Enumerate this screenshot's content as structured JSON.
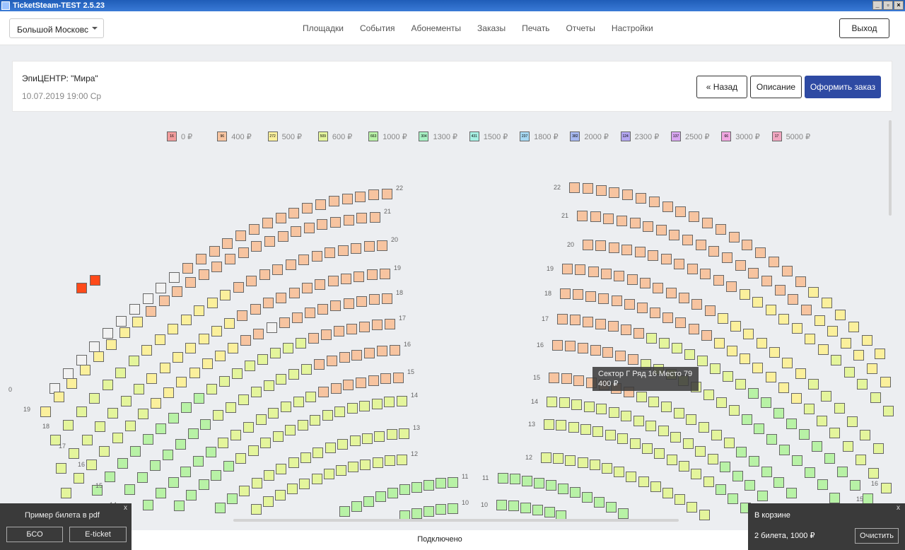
{
  "window": {
    "title": "TicketSteam-TEST 2.5.23"
  },
  "header": {
    "city": "Большой Московс",
    "nav": [
      "Площадки",
      "События",
      "Абонементы",
      "Заказы",
      "Печать",
      "Отчеты",
      "Настройки"
    ],
    "exit_label": "Выход"
  },
  "event": {
    "title": "ЭпиЦЕНТР: \"Мира\"",
    "date": "10.07.2019 19:00  Ср",
    "back_label": "«  Назад",
    "description_label": "Описание",
    "order_label": "Оформить заказ"
  },
  "legend": [
    {
      "count": "16",
      "price": "0 ₽",
      "color": "#f19c9c"
    },
    {
      "count": "96",
      "price": "400 ₽",
      "color": "#f7c4a0"
    },
    {
      "count": "272",
      "price": "500 ₽",
      "color": "#fbf09c"
    },
    {
      "count": "509",
      "price": "600 ₽",
      "color": "#e4f59c"
    },
    {
      "count": "663",
      "price": "1000 ₽",
      "color": "#b8f2a6"
    },
    {
      "count": "304",
      "price": "1300 ₽",
      "color": "#a6f0c2"
    },
    {
      "count": "431",
      "price": "1500 ₽",
      "color": "#a6f0e3"
    },
    {
      "count": "237",
      "price": "1800 ₽",
      "color": "#a6d8f2"
    },
    {
      "count": "382",
      "price": "2000 ₽",
      "color": "#a6b8f0"
    },
    {
      "count": "124",
      "price": "2300 ₽",
      "color": "#b3a6f0"
    },
    {
      "count": "137",
      "price": "2500 ₽",
      "color": "#d8a6f0"
    },
    {
      "count": "66",
      "price": "3000 ₽",
      "color": "#f0a6e0"
    },
    {
      "count": "17",
      "price": "5000 ₽",
      "color": "#f0a6c0"
    }
  ],
  "seat_colors": {
    "p400": "#f7c4a0",
    "p500": "#fbf09c",
    "p600": "#e4f59c",
    "p1000": "#b8f2a6",
    "p1300": "#a6f0c2",
    "sold": "#f2f2f2",
    "selected": "#ff4a1a",
    "dark": "#2f5a2f"
  },
  "row_labels_left": [
    "22",
    "21",
    "20",
    "19",
    "18",
    "17",
    "16",
    "15",
    "14",
    "13",
    "12",
    "11",
    "10"
  ],
  "row_labels_left_outer": [
    "0",
    "19",
    "18",
    "17",
    "16",
    "15",
    "14"
  ],
  "row_labels_right": [
    "22",
    "21",
    "20",
    "19",
    "18",
    "17",
    "16",
    "15",
    "14",
    "13",
    "12",
    "11",
    "10"
  ],
  "row_labels_right_outer": [
    "16",
    "15"
  ],
  "tooltip": {
    "line1": "Сектор Г Ряд 16 Место 79",
    "line2": "400 ₽"
  },
  "status": "Подключено",
  "pdf_panel": {
    "title": "Пример билета в pdf",
    "close": "x",
    "bso_label": "БСО",
    "eticket_label": "E-ticket"
  },
  "cart": {
    "title": "В корзине",
    "summary": "2 билета, 1000 ₽",
    "clear_label": "Очистить",
    "close": "x"
  }
}
